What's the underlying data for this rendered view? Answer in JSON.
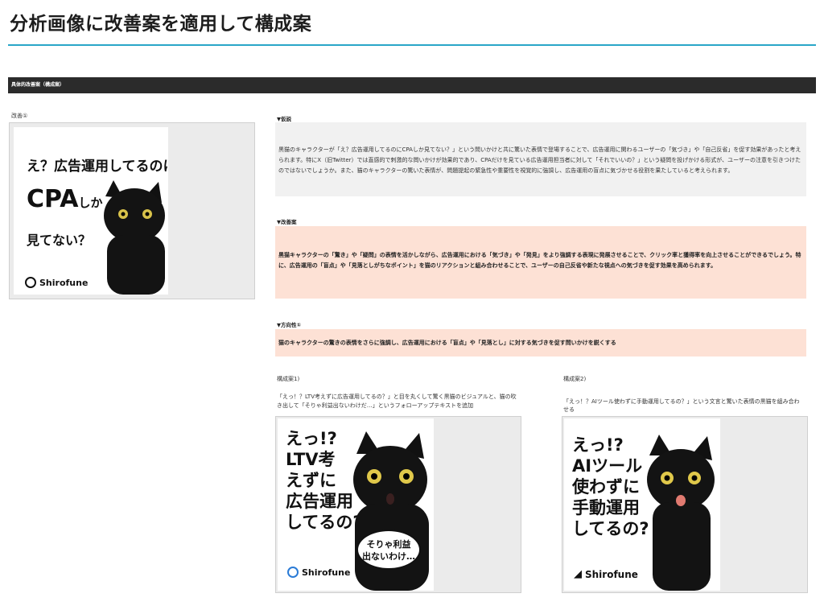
{
  "page": {
    "title": "分析画像に改善案を適用して構成案",
    "section_bar": "具体的改善案（構成案）"
  },
  "left": {
    "label": "改善①",
    "ad_line1": "え？広告運用してるのに",
    "ad_cpa": "CPA",
    "ad_shika": "しか",
    "ad_line3": "見てない？",
    "logo": "Shirofune"
  },
  "hypothesis": {
    "label": "▼仮説",
    "text": "黒猫のキャラクターが「え？広告運用してるのにCPAしか見てない？」という問いかけと共に驚いた表情で登場することで、広告運用に関わるユーザーの「気づき」や「自己反省」を促す効果があったと考えられます。特にX（旧Twitter）では直感的で刺激的な問いかけが効果的であり、CPAだけを見ている広告運用担当者に対して「それでいいの？」という疑問を投げかける形式が、ユーザーの注意を引きつけたのではないでしょうか。また、猫のキャラクターの驚いた表情が、問題提起の緊急性や重要性を視覚的に強調し、広告運用の盲点に気づかせる役割を果たしていると考えられます。"
  },
  "improvement": {
    "label": "▼改善案",
    "text": "黒猫キャラクターの「驚き」や「疑問」の表情を活かしながら、広告運用における「気づき」や「発見」をより強調する表現に発展させることで、クリック率と獲得率を向上させることができるでしょう。特に、広告運用の「盲点」や「見落としがちなポイント」を猫のリアクションと組み合わせることで、ユーザーの自己反省や新たな視点への気づきを促す効果を高められます。"
  },
  "direction": {
    "label": "▼方向性①",
    "text": "猫のキャラクターの驚きの表情をさらに強調し、広告運用における「盲点」や「見落とし」に対する気づきを促す問いかけを鋭くする"
  },
  "proposal1": {
    "label": "構成案1)",
    "desc": "「えっ！？LTV考えずに広告運用してるの？」と目を丸くして驚く黒猫のビジュアルと、猫の吹き出して「そりゃ利益出ないわけだ…」というフォローアップテキストを追加",
    "lines": [
      "えっ!?",
      "LTV考",
      "えずに",
      "広告運用",
      "してるの?"
    ],
    "bubble1": "そりゃ利益",
    "bubble2": "出ないわけ…",
    "logo": "Shirofune"
  },
  "proposal2": {
    "label": "構成案2)",
    "desc": "「えっ！？AIツール使わずに手動運用してるの？」という文言と驚いた表情の黒猫を組み合わせる",
    "lines": [
      "えっ!?",
      "AIツール",
      "使わずに",
      "手動運用",
      "してるの?"
    ],
    "logo": "Shirofune"
  },
  "colors": {
    "accent_rule": "#2aa6c8",
    "section_bar": "#2b2b2b",
    "peach_box": "#fde1d5",
    "gray_box": "#f1f1f1"
  }
}
